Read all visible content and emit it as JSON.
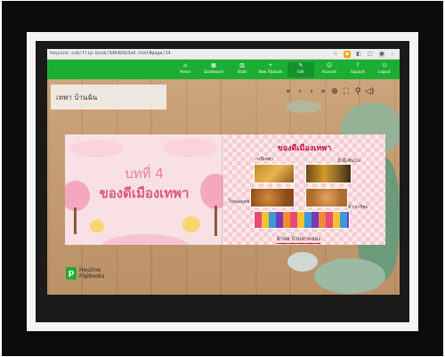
{
  "browser": {
    "url": "heyzine.com/flip-book/3d64b5b3a9.html#page/14"
  },
  "app_nav": {
    "items": [
      {
        "icon": "home-icon",
        "glyph": "⌂",
        "label": "Home"
      },
      {
        "icon": "dashboard-icon",
        "glyph": "▦",
        "label": "Dashboard"
      },
      {
        "icon": "stats-icon",
        "glyph": "▥",
        "label": "Stats"
      },
      {
        "icon": "new-flipbook-icon",
        "glyph": "+",
        "label": "New Flipbook"
      },
      {
        "icon": "edit-icon",
        "glyph": "✎",
        "label": "Edit"
      },
      {
        "icon": "account-icon",
        "glyph": "☺",
        "label": "Account"
      },
      {
        "icon": "support-icon",
        "glyph": "?",
        "label": "Support"
      },
      {
        "icon": "logout-icon",
        "glyph": "⏻",
        "label": "Logout"
      }
    ]
  },
  "flipbook_title": "เทพา บ้านฉัน",
  "viewer_toolbar": [
    "«",
    "‹",
    "›",
    "»",
    "⊕",
    "⛶",
    "⚲",
    "◁)"
  ],
  "left_page": {
    "chapter": "บทที่ 4",
    "title": "ของดีเมืองเทพา"
  },
  "right_page": {
    "title": "ของดีเมืองเทพา",
    "labels": [
      "กะปิเทพา",
      "น้ำผึ้งชันโรง",
      "ไก่ทอดเทพา",
      "ข้าวเกรียบ"
    ],
    "footer": "ผ้าทอ บ้านท่าคลอง"
  },
  "brand": {
    "name": "Heyzine",
    "sub": "Flipbooks"
  },
  "colors": {
    "nav_green": "#1cae33",
    "chapter_pink": "#e0557e",
    "right_title_red": "#c2184b"
  }
}
